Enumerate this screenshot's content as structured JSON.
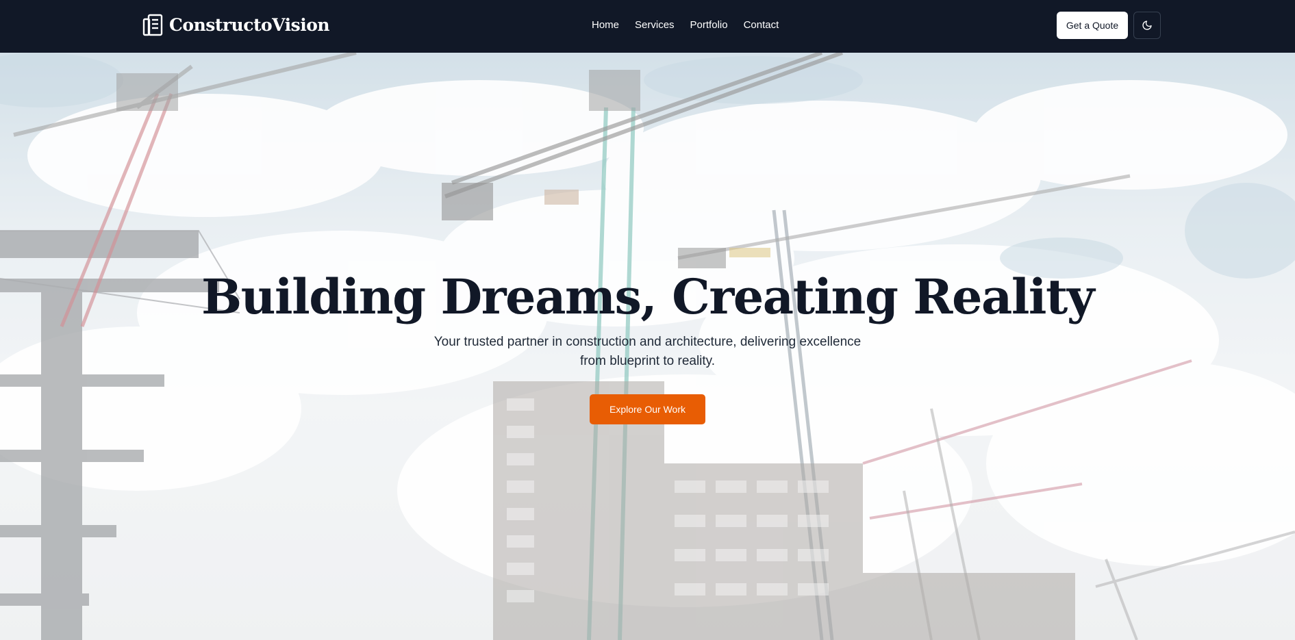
{
  "brand": {
    "name": "ConstructoVision",
    "logo_icon": "building-icon"
  },
  "nav": {
    "items": [
      {
        "label": "Home"
      },
      {
        "label": "Services"
      },
      {
        "label": "Portfolio"
      },
      {
        "label": "Contact"
      }
    ]
  },
  "header_actions": {
    "quote_label": "Get a Quote",
    "theme_icon": "moon-icon"
  },
  "hero": {
    "title": "Building Dreams, Creating Reality",
    "subtitle": "Your trusted partner in construction and architecture, delivering excellence from blueprint to reality.",
    "cta_label": "Explore Our Work",
    "background": "construction-site-cranes-photo"
  },
  "colors": {
    "header_bg": "#111827",
    "accent": "#e85d04",
    "text_dark": "#111827"
  }
}
